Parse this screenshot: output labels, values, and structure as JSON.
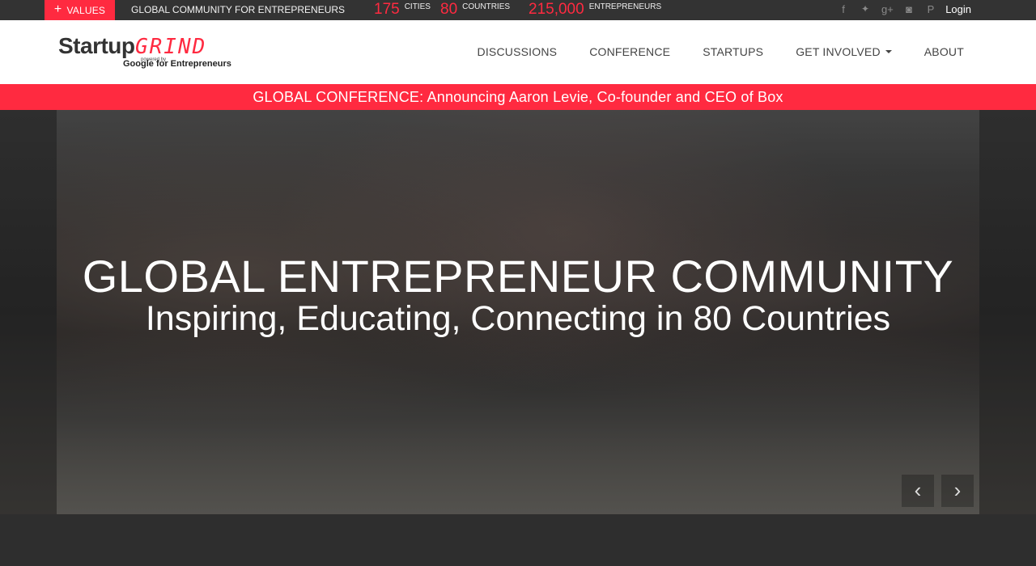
{
  "topbar": {
    "values_label": "VALUES",
    "tagline": "GLOBAL COMMUNITY FOR ENTREPRENEURS",
    "stats": [
      {
        "number": "175",
        "label": "CITIES"
      },
      {
        "number": "80",
        "label": "COUNTRIES"
      },
      {
        "number": "215,000",
        "label": "ENTREPRENEURS"
      }
    ],
    "social": [
      {
        "icon": "facebook-icon",
        "glyph": "f"
      },
      {
        "icon": "twitter-icon",
        "glyph": "🐦"
      },
      {
        "icon": "google-plus-icon",
        "glyph": "g+"
      },
      {
        "icon": "instagram-icon",
        "glyph": "◙"
      },
      {
        "icon": "pinterest-icon",
        "glyph": "P"
      }
    ],
    "login_label": "Login"
  },
  "navbar": {
    "logo": {
      "main": "Startup",
      "accent": "GRIND",
      "powered": "powered by",
      "sub": "Google for Entrepreneurs"
    },
    "menu": [
      {
        "label": "DISCUSSIONS"
      },
      {
        "label": "CONFERENCE"
      },
      {
        "label": "STARTUPS"
      },
      {
        "label": "GET INVOLVED"
      },
      {
        "label": "ABOUT"
      }
    ]
  },
  "announcement": "GLOBAL CONFERENCE: Announcing Aaron Levie, Co-founder and CEO of Box",
  "hero": {
    "title": "GLOBAL ENTREPRENEUR COMMUNITY",
    "subtitle": "Inspiring, Educating, Connecting in 80 Countries",
    "prev_glyph": "‹",
    "next_glyph": "›"
  },
  "colors": {
    "accent": "#ff2a40",
    "topbar": "#333333",
    "footer": "#2e2e2e"
  }
}
